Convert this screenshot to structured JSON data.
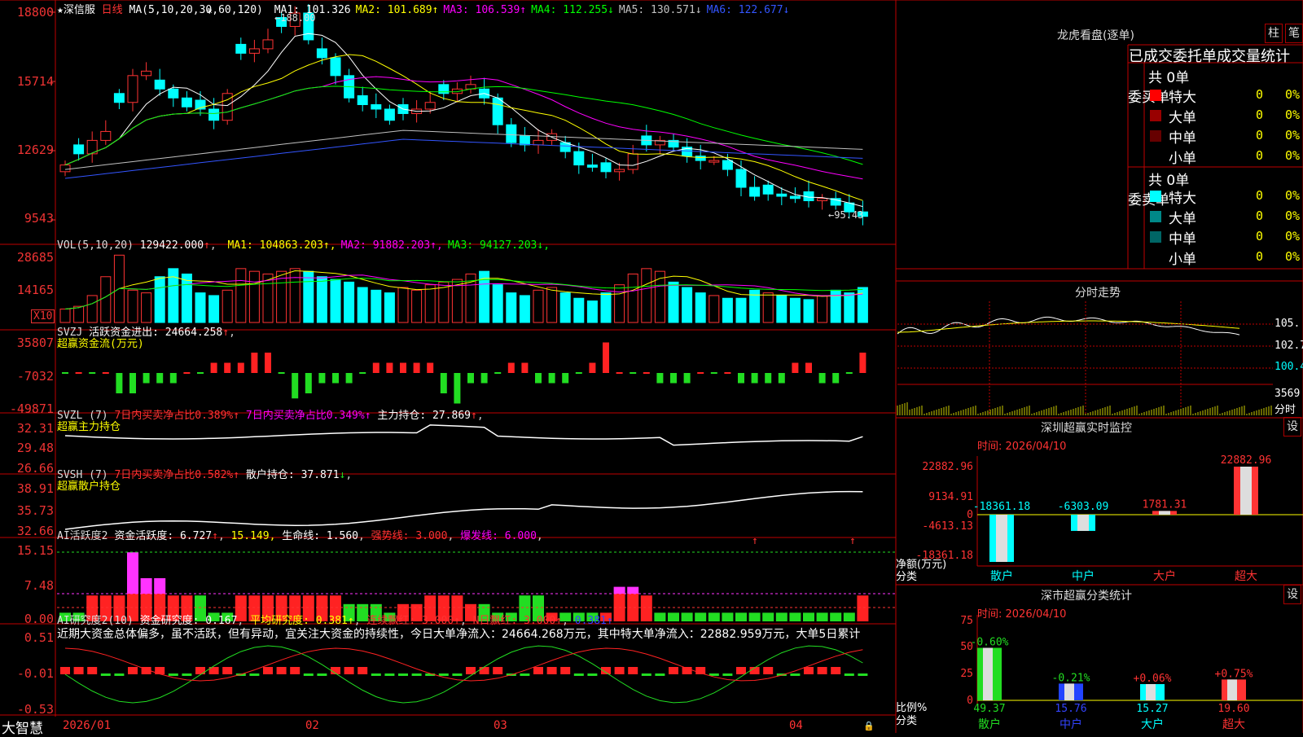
{
  "chart_header": {
    "stock_name": "深信服",
    "period": "日线",
    "ma_params": "MA(5,10,20,30,60,120)",
    "ma": [
      {
        "label": "MA1:",
        "value": "101.326",
        "color": "#ffffff"
      },
      {
        "label": "MA2:",
        "value": "101.689",
        "color": "#ffff00"
      },
      {
        "label": "MA3:",
        "value": "106.539",
        "color": "#ff00ff"
      },
      {
        "label": "MA4:",
        "value": "112.255",
        "color": "#00ff00"
      },
      {
        "label": "MA5:",
        "value": "130.571",
        "color": "#c0c0c0"
      },
      {
        "label": "MA6:",
        "value": "122.677",
        "color": "#3355ff"
      }
    ],
    "high_label": "188.00",
    "low_label": "95.43",
    "star": "★",
    "asterisk": "*"
  },
  "price_axis": [
    "18800",
    "15714",
    "12629",
    "9543"
  ],
  "vol_panel": {
    "title": "VOL(5,10,20)",
    "value": "129422.000",
    "ma": [
      {
        "label": "MA1:",
        "value": "104863.203",
        "color": "#ffff00"
      },
      {
        "label": "MA2:",
        "value": "91882.203",
        "color": "#ff00ff"
      },
      {
        "label": "MA3:",
        "value": "94127.203",
        "color": "#00ff00"
      }
    ],
    "axis": [
      "28685",
      "14165"
    ],
    "unit": "X10"
  },
  "svzj_panel": {
    "title": "SVZJ",
    "line1_label": "活跃资金进出:",
    "line1_value": "24664.258",
    "line2": "超赢资金流(万元)",
    "axis": [
      "35807",
      "-7032",
      "-49871"
    ]
  },
  "svzl_panel": {
    "title": "SVZL (7)",
    "a": "7日内买卖净占比0.389%",
    "b": "7日内买卖净占比0.349%",
    "c_label": "主力持仓:",
    "c_value": "27.869",
    "line2": "超赢主力持仓",
    "axis": [
      "32.31",
      "29.48",
      "26.66"
    ]
  },
  "svsh_panel": {
    "title": "SVSH (7)",
    "a": "7日内买卖净占比0.582%",
    "c_label": "散户持仓:",
    "c_value": "37.871",
    "line2": "超赢散户持仓",
    "axis": [
      "38.91",
      "35.73",
      "32.66"
    ]
  },
  "ai_panel": {
    "title": "AI活跃度2",
    "a_label": "资金活跃度:",
    "a_value": "6.727",
    "b_value": "15.149",
    "c_label": "生命线:",
    "c_value": "1.560",
    "d": "强势线: 3.000",
    "e": "爆发线: 6.000",
    "axis": [
      "15.15",
      "7.48",
      "0.00"
    ]
  },
  "ai2_panel": {
    "title": "AI研究度2(10)",
    "a_label": "资金研究度:",
    "a_value": "0.167",
    "b": "平均研究度: 0.381",
    "c": "连续飘红: 3.000",
    "d": "N日飘红: 3.000",
    "e": "0.381",
    "comment": "近期大资金总体偏多，虽不活跃，但有异动，宜关注大资金的持续性，今日大单净流入：24664.268万元，其中特大单净流入：22882.959万元，大单5日累计",
    "axis": [
      "0.51",
      "-0.01",
      "-0.53"
    ]
  },
  "date_axis": [
    "2026/01",
    "02",
    "03",
    "04"
  ],
  "brand": "大智慧",
  "right_panel": {
    "lhb_title": "龙虎看盘(逐单)",
    "btn_zhu": "柱",
    "btn_bi": "笔",
    "table_title": "已成交委托单成交量统计",
    "buy": {
      "side_label": "委买单",
      "total": "共 0单",
      "rows": [
        {
          "name": "特大",
          "count": "0",
          "pct": "0%",
          "color": "#ff0000"
        },
        {
          "name": "大单",
          "count": "0",
          "pct": "0%",
          "color": "#990000"
        },
        {
          "name": "中单",
          "count": "0",
          "pct": "0%",
          "color": "#660000"
        },
        {
          "name": "小单",
          "count": "0",
          "pct": "0%",
          "color": "#000000"
        }
      ]
    },
    "sell": {
      "side_label": "委卖单",
      "total": "共 0单",
      "rows": [
        {
          "name": "特大",
          "count": "0",
          "pct": "0%",
          "color": "#00ffff"
        },
        {
          "name": "大单",
          "count": "0",
          "pct": "0%",
          "color": "#008888"
        },
        {
          "name": "中单",
          "count": "0",
          "pct": "0%",
          "color": "#006666"
        },
        {
          "name": "小单",
          "count": "0",
          "pct": "0%",
          "color": "#000000"
        }
      ]
    },
    "fenshi": {
      "title": "分时走势",
      "axis": [
        "105.",
        "102.7",
        "100.4"
      ],
      "vol_label": "3569",
      "vol_caption": "分时"
    },
    "monitor": {
      "title": "深圳超赢实时监控",
      "btn": "设",
      "time": "时间: 2026/04/10",
      "axis": [
        "22882.96",
        "9134.91",
        "0",
        "-4613.13",
        "-18361.18"
      ],
      "ylabel": "净额(万元)",
      "xlabel": "分类",
      "bars": [
        {
          "label": "散户",
          "value": "-18361.18",
          "num": -18361.18,
          "color": "#00ffff"
        },
        {
          "label": "中户",
          "value": "-6303.09",
          "num": -6303.09,
          "color": "#00ffff"
        },
        {
          "label": "大户",
          "value": "1781.31",
          "num": 1781.31,
          "color": "#ff3333"
        },
        {
          "label": "超大",
          "value": "22882.96",
          "num": 22882.96,
          "color": "#ff3333"
        }
      ]
    },
    "classify": {
      "title": "深市超赢分类统计",
      "btn": "设",
      "time": "时间: 2026/04/10",
      "axis": [
        "75",
        "50",
        "25",
        "0"
      ],
      "ylabel": "比例%",
      "xlabel": "分类",
      "bars": [
        {
          "label": "散户",
          "value": "49.37",
          "delta": "-0.60%",
          "num": 49.37,
          "color": "#22dd22",
          "label_color": "#22dd22",
          "delta_color": "#22dd22"
        },
        {
          "label": "中户",
          "value": "15.76",
          "delta": "-0.21%",
          "num": 15.76,
          "color": "#2244ff",
          "label_color": "#3344ff",
          "delta_color": "#22dd22"
        },
        {
          "label": "大户",
          "value": "15.27",
          "delta": "+0.06%",
          "num": 15.27,
          "color": "#00ffff",
          "label_color": "#00ffff",
          "delta_color": "#ff3333"
        },
        {
          "label": "超大",
          "value": "19.60",
          "delta": "+0.75%",
          "num": 19.6,
          "color": "#ff3333",
          "label_color": "#ff3333",
          "delta_color": "#ff3333"
        }
      ]
    }
  },
  "colors": {
    "up": "#ff3333",
    "down": "#00ffff",
    "grid": "#c00000",
    "bg": "#000000"
  }
}
